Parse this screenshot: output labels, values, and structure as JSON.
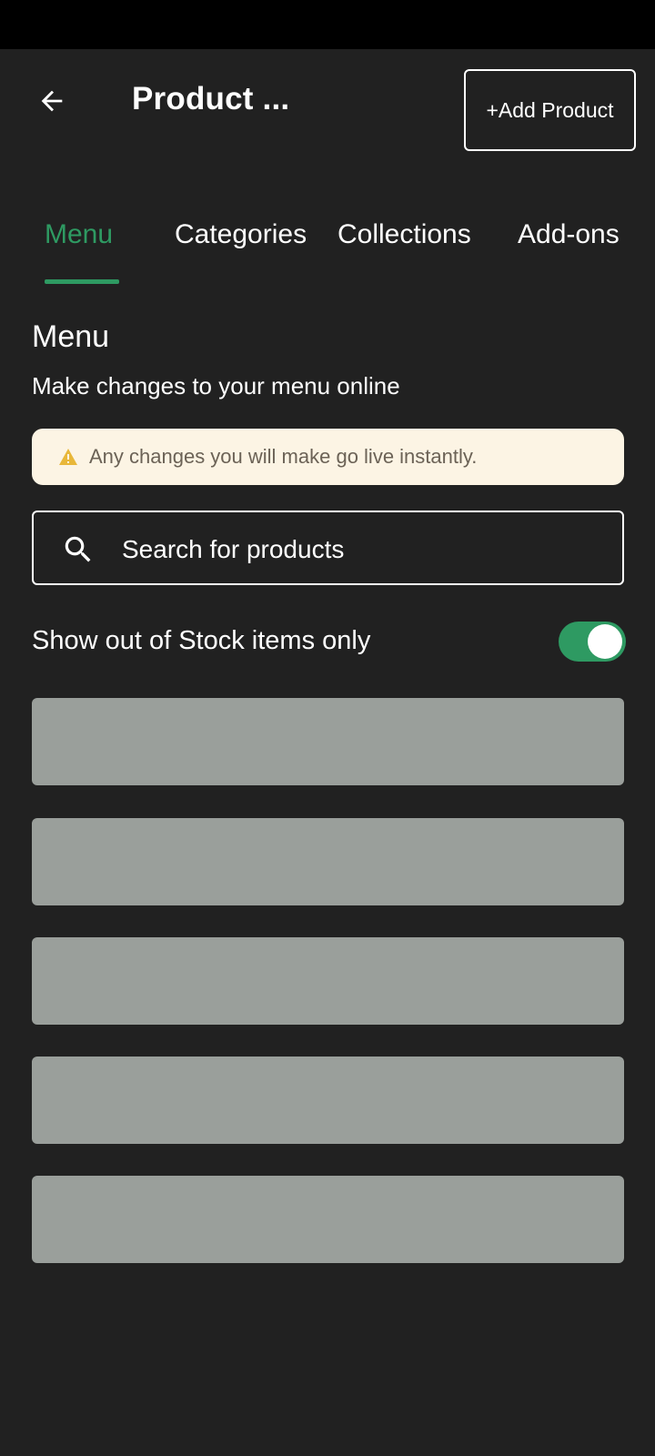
{
  "header": {
    "title": "Product ...",
    "add_product_label": "+Add Product"
  },
  "tabs": [
    {
      "label": "Menu",
      "active": true
    },
    {
      "label": "Categories",
      "active": false
    },
    {
      "label": "Collections",
      "active": false
    },
    {
      "label": "Add-ons",
      "active": false
    }
  ],
  "section": {
    "title": "Menu",
    "subtitle": "Make changes to your menu online"
  },
  "notice": {
    "icon": "warning-icon",
    "text": "Any changes you will make go live instantly."
  },
  "search": {
    "icon": "search-icon",
    "placeholder": "Search for products"
  },
  "filter": {
    "label": "Show out of Stock items only",
    "enabled": true
  },
  "colors": {
    "background": "#212121",
    "accent": "#2e9a62",
    "notice_background": "#fcf4e4",
    "warning": "#e8b73a",
    "skeleton": "#9a9f9b"
  }
}
